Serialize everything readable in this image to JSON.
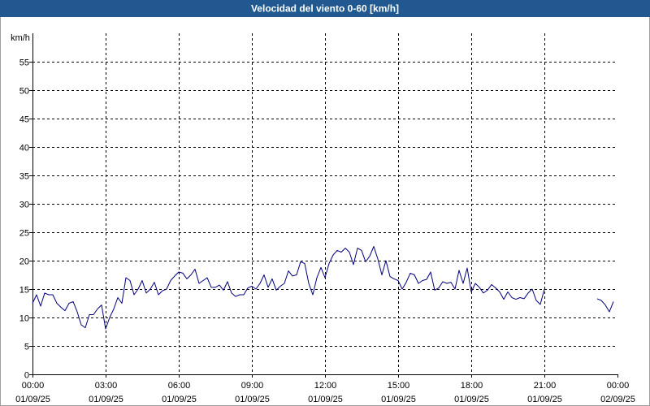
{
  "colors": {
    "title_bar": "#20588f",
    "title_text": "#ffffff",
    "line": "#00007f",
    "grid": "#000000",
    "axis": "#000000",
    "frame_border": "#a0a0a0"
  },
  "chart_data": {
    "type": "line",
    "title": "Velocidad del viento 0-60 [km/h]",
    "ylabel": "km/h",
    "ylim": [
      0,
      60
    ],
    "yticks": [
      0,
      5,
      10,
      15,
      20,
      25,
      30,
      35,
      40,
      45,
      50,
      55
    ],
    "xlim": [
      "01/09/25 00:00",
      "02/09/25 00:00"
    ],
    "xticks": [
      {
        "time": "00:00",
        "date": "01/09/25"
      },
      {
        "time": "03:00",
        "date": "01/09/25"
      },
      {
        "time": "06:00",
        "date": "01/09/25"
      },
      {
        "time": "09:00",
        "date": "01/09/25"
      },
      {
        "time": "12:00",
        "date": "01/09/25"
      },
      {
        "time": "15:00",
        "date": "01/09/25"
      },
      {
        "time": "18:00",
        "date": "01/09/25"
      },
      {
        "time": "21:00",
        "date": "01/09/25"
      },
      {
        "time": "00:00",
        "date": "02/09/25"
      }
    ],
    "grid": true,
    "grid_style": "dashed",
    "legend": "none",
    "series": [
      {
        "color": "#00007f",
        "segments": [
          [
            [
              "00:00",
              12.5
            ],
            [
              "00:10",
              14
            ],
            [
              "00:20",
              12
            ],
            [
              "00:30",
              14.3
            ],
            [
              "00:40",
              14
            ],
            [
              "00:50",
              14
            ],
            [
              "01:00",
              12.5
            ],
            [
              "01:10",
              11.8
            ],
            [
              "01:20",
              11.2
            ],
            [
              "01:30",
              12.5
            ],
            [
              "01:40",
              12.8
            ],
            [
              "01:50",
              11
            ],
            [
              "02:00",
              8.7
            ],
            [
              "02:10",
              8.2
            ],
            [
              "02:20",
              10.5
            ],
            [
              "02:30",
              10.5
            ],
            [
              "02:40",
              11.5
            ],
            [
              "02:50",
              12.2
            ],
            [
              "03:00",
              8
            ],
            [
              "03:10",
              10
            ],
            [
              "03:20",
              11.5
            ],
            [
              "03:30",
              13.5
            ],
            [
              "03:40",
              12.5
            ],
            [
              "03:50",
              17
            ],
            [
              "04:00",
              16.5
            ],
            [
              "04:10",
              14
            ],
            [
              "04:20",
              15
            ],
            [
              "04:30",
              16.5
            ],
            [
              "04:40",
              14.3
            ],
            [
              "04:50",
              15
            ],
            [
              "05:00",
              16.2
            ],
            [
              "05:10",
              14
            ],
            [
              "05:20",
              14.7
            ],
            [
              "05:30",
              15
            ],
            [
              "05:40",
              16.5
            ],
            [
              "05:50",
              17.3
            ],
            [
              "06:00",
              18
            ],
            [
              "06:10",
              17.8
            ],
            [
              "06:20",
              16.8
            ],
            [
              "06:30",
              17.5
            ],
            [
              "06:40",
              18.5
            ],
            [
              "06:50",
              16
            ],
            [
              "07:00",
              16.5
            ],
            [
              "07:10",
              17
            ],
            [
              "07:20",
              15.3
            ],
            [
              "07:30",
              15.3
            ],
            [
              "07:40",
              15.7
            ],
            [
              "07:50",
              14.8
            ],
            [
              "08:00",
              16.3
            ],
            [
              "08:10",
              14.3
            ],
            [
              "08:20",
              13.7
            ],
            [
              "08:30",
              14
            ],
            [
              "08:40",
              14
            ],
            [
              "08:50",
              15.2
            ],
            [
              "09:00",
              15.5
            ],
            [
              "09:10",
              15
            ],
            [
              "09:20",
              16
            ],
            [
              "09:30",
              17.5
            ],
            [
              "09:40",
              15.3
            ],
            [
              "09:50",
              16.8
            ],
            [
              "10:00",
              14.8
            ],
            [
              "10:10",
              15.5
            ],
            [
              "10:20",
              16
            ],
            [
              "10:30",
              18.2
            ],
            [
              "10:40",
              17.3
            ],
            [
              "10:50",
              17.5
            ],
            [
              "11:00",
              19.8
            ],
            [
              "11:10",
              19.5
            ],
            [
              "11:20",
              16
            ],
            [
              "11:30",
              14
            ],
            [
              "11:40",
              17
            ],
            [
              "11:50",
              18.8
            ],
            [
              "12:00",
              17
            ],
            [
              "12:10",
              19.5
            ],
            [
              "12:20",
              21
            ],
            [
              "12:30",
              21.8
            ],
            [
              "12:40",
              21.5
            ],
            [
              "12:50",
              22.2
            ],
            [
              "13:00",
              21.5
            ],
            [
              "13:10",
              19.3
            ],
            [
              "13:20",
              22.2
            ],
            [
              "13:30",
              21.8
            ],
            [
              "13:40",
              19.8
            ],
            [
              "13:50",
              20.8
            ],
            [
              "14:00",
              22.5
            ],
            [
              "14:10",
              20.3
            ],
            [
              "14:20",
              17.5
            ],
            [
              "14:30",
              20
            ],
            [
              "14:40",
              17.2
            ],
            [
              "14:50",
              16.8
            ],
            [
              "15:00",
              16.5
            ],
            [
              "15:10",
              15
            ],
            [
              "15:20",
              16.2
            ],
            [
              "15:30",
              17.8
            ],
            [
              "15:40",
              17.5
            ],
            [
              "15:50",
              16
            ],
            [
              "16:00",
              16.5
            ],
            [
              "16:10",
              16.7
            ],
            [
              "16:20",
              18
            ],
            [
              "16:30",
              14.8
            ],
            [
              "16:40",
              15.2
            ],
            [
              "16:50",
              16.3
            ],
            [
              "17:00",
              16
            ],
            [
              "17:10",
              16.2
            ],
            [
              "17:20",
              15
            ],
            [
              "17:30",
              18.3
            ],
            [
              "17:40",
              16
            ],
            [
              "17:50",
              18.7
            ],
            [
              "18:00",
              14.5
            ],
            [
              "18:10",
              16
            ],
            [
              "18:20",
              15.3
            ],
            [
              "18:30",
              14.3
            ],
            [
              "18:40",
              14.8
            ],
            [
              "18:50",
              15.8
            ],
            [
              "19:00",
              15.2
            ],
            [
              "19:10",
              14.5
            ],
            [
              "19:20",
              13.2
            ],
            [
              "19:30",
              14.5
            ],
            [
              "19:40",
              13.5
            ],
            [
              "19:50",
              13.2
            ],
            [
              "20:00",
              13.5
            ],
            [
              "20:10",
              13.3
            ],
            [
              "20:20",
              14.3
            ],
            [
              "20:30",
              15
            ],
            [
              "20:40",
              13
            ],
            [
              "20:50",
              12.3
            ],
            [
              "21:00",
              15
            ]
          ],
          [
            [
              "23:10",
              13.3
            ],
            [
              "23:20",
              13
            ],
            [
              "23:30",
              12.2
            ],
            [
              "23:40",
              11
            ],
            [
              "23:50",
              12.8
            ]
          ]
        ]
      }
    ]
  }
}
